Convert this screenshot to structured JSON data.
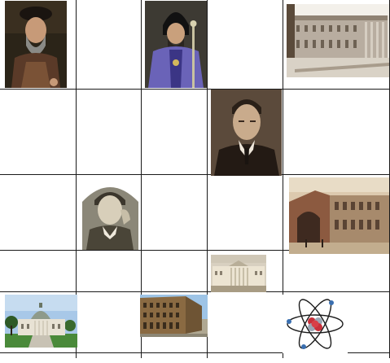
{
  "collage": {
    "columns": 5,
    "rows": 5,
    "cells": [
      {
        "row": 1,
        "col": 1,
        "content": "portrait-bearded-nobleman"
      },
      {
        "row": 1,
        "col": 3,
        "content": "portrait-archbishop"
      },
      {
        "row": 1,
        "col": 5,
        "content": "photo-neoclassical-palace"
      },
      {
        "row": 2,
        "col": 4,
        "content": "portrait-young-man-suit"
      },
      {
        "row": 3,
        "col": 2,
        "content": "engraving-writer-portrait"
      },
      {
        "row": 3,
        "col": 5,
        "content": "photo-university-building"
      },
      {
        "row": 4,
        "col": 4,
        "content": "photo-classical-building"
      },
      {
        "row": 5,
        "col": 1,
        "content": "photo-rotunda-villa"
      },
      {
        "row": 5,
        "col": 3,
        "content": "photo-brick-building"
      },
      {
        "row": 5,
        "col": 5,
        "content": "atom-illustration"
      }
    ]
  },
  "colors": {
    "grid_line": "#1a1a1a",
    "background": "#ffffff",
    "atom_nucleus_red": "#c8303a",
    "atom_electron_blue": "#3a6fb0"
  }
}
